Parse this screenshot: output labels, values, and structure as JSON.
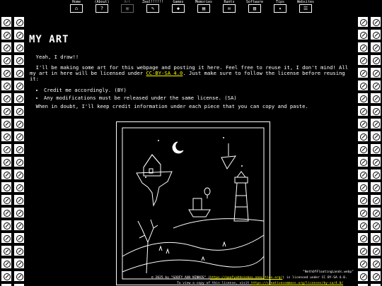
{
  "nav": {
    "items": [
      {
        "label": "Home",
        "icon": "home-icon",
        "glyph": "⌂"
      },
      {
        "label": "(About)",
        "icon": "about-icon",
        "glyph": "?"
      },
      {
        "label": "Art",
        "icon": "art-icon",
        "glyph": "▣"
      },
      {
        "label": "Zeal!!!!!!",
        "icon": "zeal-icon",
        "glyph": "✎"
      },
      {
        "label": "Games",
        "icon": "games-icon",
        "glyph": "◆"
      },
      {
        "label": "Memories",
        "icon": "memories-icon",
        "glyph": "▤"
      },
      {
        "label": "Rants",
        "icon": "rants-icon",
        "glyph": "✉"
      },
      {
        "label": "Software",
        "icon": "software-icon",
        "glyph": "▥"
      },
      {
        "label": "Tips",
        "icon": "tips-icon",
        "glyph": "✦"
      },
      {
        "label": "Websites",
        "icon": "websites-icon",
        "glyph": "☰"
      }
    ]
  },
  "page": {
    "title": "MY ART",
    "intro": "Yeah, I draw!!",
    "para2_a": "I'll be making some art for this webpage and posting it here. Feel free to reuse it, I don't mind! All my art in here will be licensed under ",
    "license_link": "CC-BY-SA 4.0",
    "para2_b": ". Just make sure to follow the license before reusing it:",
    "list": [
      "Credit me accordingly. (BY)",
      "Any modifications must be released under the same license. (SA)"
    ],
    "para3": "When in doubt, I'll keep credit information under each piece that you can copy and paste."
  },
  "artwork": {
    "filename": "\"NethOfFloatingLands.webp\"",
    "credit_a": "© 2025 by \"GOOFY AHH NINKOS\" (",
    "credit_link": "https://goofyahhninkos.neocities.org/",
    "credit_b": ") is licensed under CC BY-SA 4.0.",
    "license_note_a": "To view a copy of this license, visit ",
    "license_note_link": "https://creativecommons.org/licenses/by-sa/4.0/"
  },
  "colors": {
    "background": "#000000",
    "text": "#ffffff",
    "link": "#ffff00"
  }
}
